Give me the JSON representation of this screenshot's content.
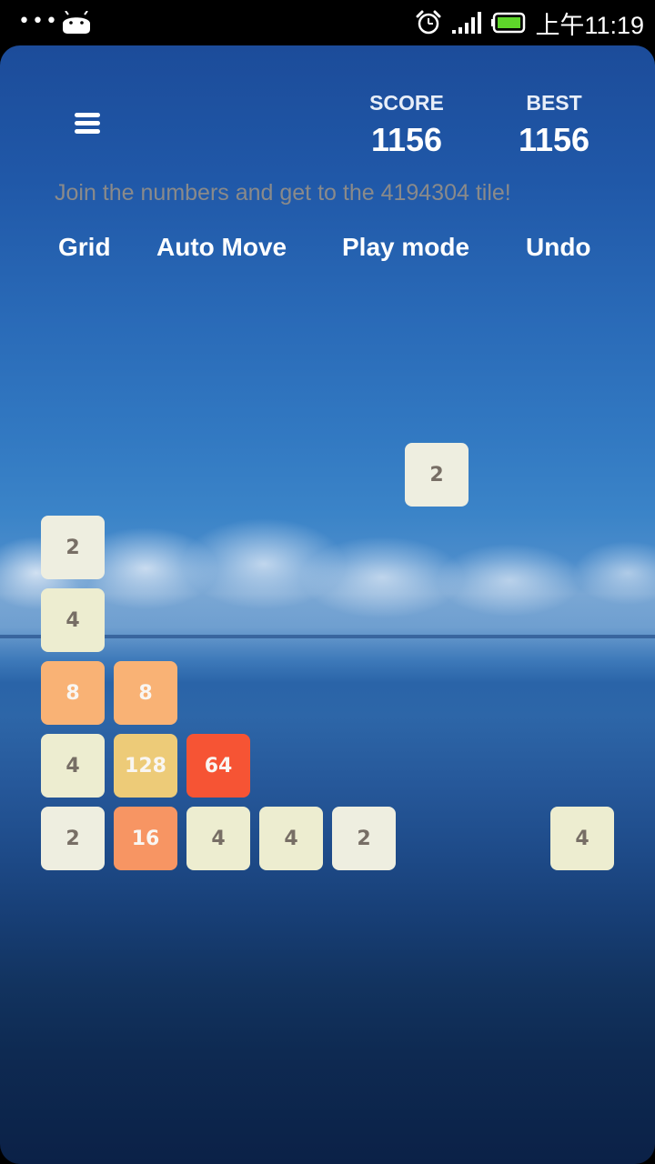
{
  "status_bar": {
    "dots": "•••",
    "notification_icon": "android-robot-icon",
    "alarm_icon": "alarm-clock-icon",
    "signal_icon": "signal-bars-icon",
    "battery_icon": "battery-icon",
    "battery_color": "#5ed62a",
    "time": "上午11:19"
  },
  "header": {
    "menu_icon": "hamburger-menu-icon",
    "score_label": "SCORE",
    "score_value": "1156",
    "best_label": "BEST",
    "best_value": "1156",
    "tagline": "Join the numbers and get to the 4194304 tile!"
  },
  "actions": [
    {
      "label": "Grid"
    },
    {
      "label": "Auto Move"
    },
    {
      "label": "Play mode"
    },
    {
      "label": "Undo"
    }
  ],
  "board": {
    "columns": 8,
    "tiles": [
      {
        "row": 0,
        "col": 5,
        "value": "2"
      },
      {
        "row": 1,
        "col": 0,
        "value": "2"
      },
      {
        "row": 2,
        "col": 0,
        "value": "4"
      },
      {
        "row": 3,
        "col": 0,
        "value": "8"
      },
      {
        "row": 3,
        "col": 1,
        "value": "8"
      },
      {
        "row": 4,
        "col": 0,
        "value": "4"
      },
      {
        "row": 4,
        "col": 1,
        "value": "128"
      },
      {
        "row": 4,
        "col": 2,
        "value": "64"
      },
      {
        "row": 5,
        "col": 0,
        "value": "2"
      },
      {
        "row": 5,
        "col": 1,
        "value": "16"
      },
      {
        "row": 5,
        "col": 2,
        "value": "4"
      },
      {
        "row": 5,
        "col": 3,
        "value": "4"
      },
      {
        "row": 5,
        "col": 4,
        "value": "2"
      },
      {
        "row": 5,
        "col": 7,
        "value": "4"
      }
    ],
    "tile_colors": {
      "2": {
        "bg": "#eeeee0",
        "fg": "#776e65"
      },
      "4": {
        "bg": "#ededd0",
        "fg": "#776e65"
      },
      "8": {
        "bg": "#f9b275",
        "fg": "#f9f6f2"
      },
      "16": {
        "bg": "#f79563",
        "fg": "#f9f6f2"
      },
      "64": {
        "bg": "#f65434",
        "fg": "#f9f6f2"
      },
      "128": {
        "bg": "#edcb78",
        "fg": "#f9f6f2"
      }
    }
  }
}
